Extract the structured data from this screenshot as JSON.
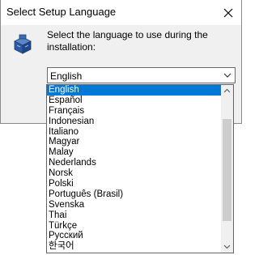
{
  "dialog": {
    "title": "Select Setup Language",
    "prompt": "Select the language to use during the installation:",
    "combo_value": "English"
  },
  "list": {
    "items": [
      "English",
      "Español",
      "Français",
      "Indonesian",
      "Italiano",
      "Magyar",
      "Malay",
      "Nederlands",
      "Norsk",
      "Polski",
      "Português (Brasil)",
      "Svenska",
      "Thai",
      "Türkçe",
      "Русский",
      "한국어"
    ],
    "selected": "English"
  },
  "icons": {
    "app": "setup-package-icon",
    "close": "close-icon",
    "combo_arrow": "chevron-down-icon",
    "scroll_up": "scroll-up-arrow-icon",
    "scroll_down": "scroll-down-arrow-icon"
  },
  "colors": {
    "selection": "#0078d7",
    "dialog_bg": "#f0f0f0",
    "scroll_thumb": "#cdcdcd"
  }
}
